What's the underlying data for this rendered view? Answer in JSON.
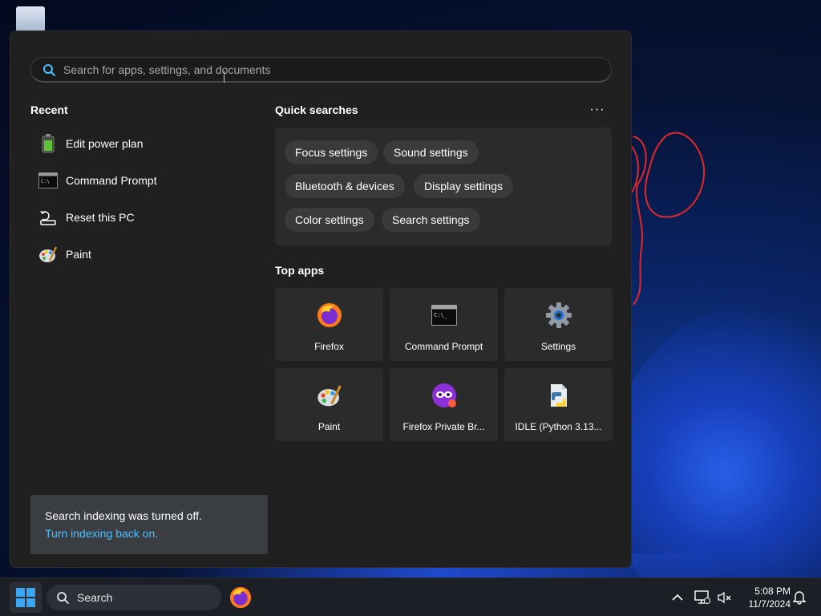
{
  "search": {
    "placeholder": "Search for apps, settings, and documents"
  },
  "recent": {
    "title": "Recent",
    "items": [
      {
        "label": "Edit power plan",
        "icon": "battery-icon"
      },
      {
        "label": "Command Prompt",
        "icon": "terminal-icon"
      },
      {
        "label": "Reset this PC",
        "icon": "reset-pc-icon"
      },
      {
        "label": "Paint",
        "icon": "paint-palette-icon"
      }
    ]
  },
  "quick_searches": {
    "title": "Quick searches",
    "more_label": "···",
    "chips": [
      "Focus settings",
      "Sound settings",
      "Bluetooth & devices",
      "Display settings",
      "Color settings",
      "Search settings"
    ]
  },
  "top_apps": {
    "title": "Top apps",
    "items": [
      {
        "label": "Firefox",
        "icon": "firefox-icon"
      },
      {
        "label": "Command Prompt",
        "icon": "terminal-icon"
      },
      {
        "label": "Settings",
        "icon": "gear-icon"
      },
      {
        "label": "Paint",
        "icon": "paint-palette-icon"
      },
      {
        "label": "Firefox Private Br...",
        "icon": "firefox-private-icon"
      },
      {
        "label": "IDLE (Python 3.13...",
        "icon": "python-idle-icon"
      }
    ]
  },
  "notice": {
    "message": "Search indexing was turned off.",
    "link": "Turn indexing back on."
  },
  "taskbar": {
    "search_label": "Search",
    "time": "5:08 PM",
    "date": "11/7/2024"
  },
  "colors": {
    "panel_bg": "#202020",
    "tile_bg": "#2b2b2b",
    "chip_bg": "#3a3a3a",
    "link": "#4cc2ff",
    "taskbar_bg": "#1c1f26"
  }
}
